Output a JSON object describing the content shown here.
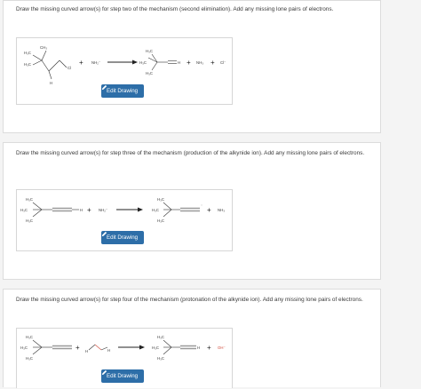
{
  "questions": [
    {
      "prompt": "Draw the missing curved arrow(s) for step two of the mechanism (second elimination). Add any missing lone pairs of electrons.",
      "button_label": "Edit Drawing",
      "reactant_labels": [
        "CH₃",
        "H₃C",
        "H₃C",
        "H",
        "Cl"
      ],
      "reagent": "NH₂⁻",
      "product_labels": [
        "H₃C",
        "H₃C",
        "H₃C",
        "H",
        "NH₃",
        "Cl⁻"
      ]
    },
    {
      "prompt": "Draw the missing curved arrow(s) for step three of the mechanism (production of the alkynide ion). Add any missing lone pairs of electrons.",
      "button_label": "Edit Drawing",
      "reactant_labels": [
        "H₃C",
        "H₃C",
        "H₃C",
        "H"
      ],
      "reagent": "NH₂⁻",
      "product_labels": [
        "H₃C",
        "H₃C",
        "H₃C",
        "⁻",
        "NH₃"
      ]
    },
    {
      "prompt": "Draw the missing curved arrow(s) for step four of the mechanism (protonation of the alkynide ion). Add any missing lone pairs of electrons.",
      "button_label": "Edit Drawing",
      "reactant_labels": [
        "H₃C",
        "H₃C",
        "H₃C",
        "H",
        "H"
      ],
      "product_labels": [
        "H₃C",
        "H₃C",
        "H₃C",
        "H",
        "OH⁻"
      ]
    }
  ],
  "colors": {
    "button": "#2d6ea8",
    "card_border": "#dcdcdc",
    "bond": "#333333",
    "bond_grey": "#9a9a9a"
  },
  "icons": [
    "pencil-icon",
    "reaction-arrow-icon"
  ]
}
